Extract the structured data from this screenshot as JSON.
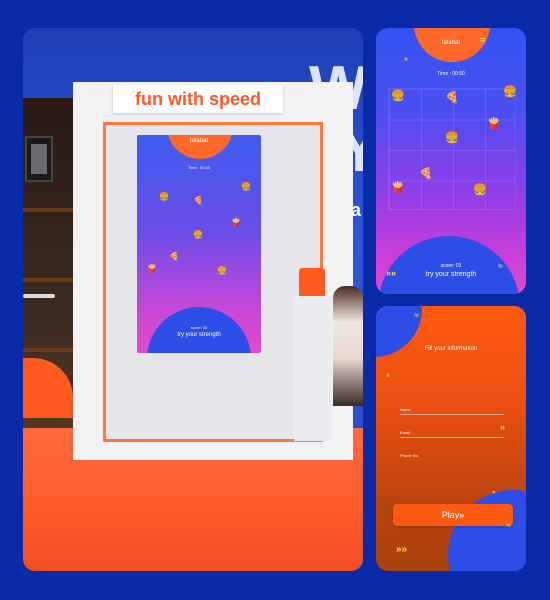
{
  "scene": {
    "sign": "fun with speed",
    "wall_text_1": "W",
    "wall_text_2": "Y",
    "wall_text_3": "ta"
  },
  "screen": {
    "brand": "talabat",
    "time": "Time : 00:00",
    "score": "score: 03",
    "cta": "try your strength"
  },
  "game": {
    "brand": "talabat",
    "time": "Time : 00:50",
    "score": "score: 03",
    "cta": "try your strength",
    "foods": [
      {
        "icon": "burger-icon",
        "glyph": "🍔"
      },
      {
        "icon": "pizza-icon",
        "glyph": "🍕"
      },
      {
        "icon": "fries-icon",
        "glyph": "🍟"
      },
      {
        "icon": "burger-icon",
        "glyph": "🍔"
      },
      {
        "icon": "pizza-icon",
        "glyph": "🍕"
      },
      {
        "icon": "fries-icon",
        "glyph": "🍟"
      }
    ]
  },
  "form": {
    "title": "Fill your information",
    "fields": [
      {
        "label": "Name"
      },
      {
        "label": "Email"
      },
      {
        "label": "Phone No."
      }
    ],
    "play_label": "Play"
  },
  "colors": {
    "background": "#0a2aa8",
    "brand_orange": "#ff5a12",
    "brand_blue": "#2d4ee6",
    "accent_yellow": "#ffe23a"
  }
}
